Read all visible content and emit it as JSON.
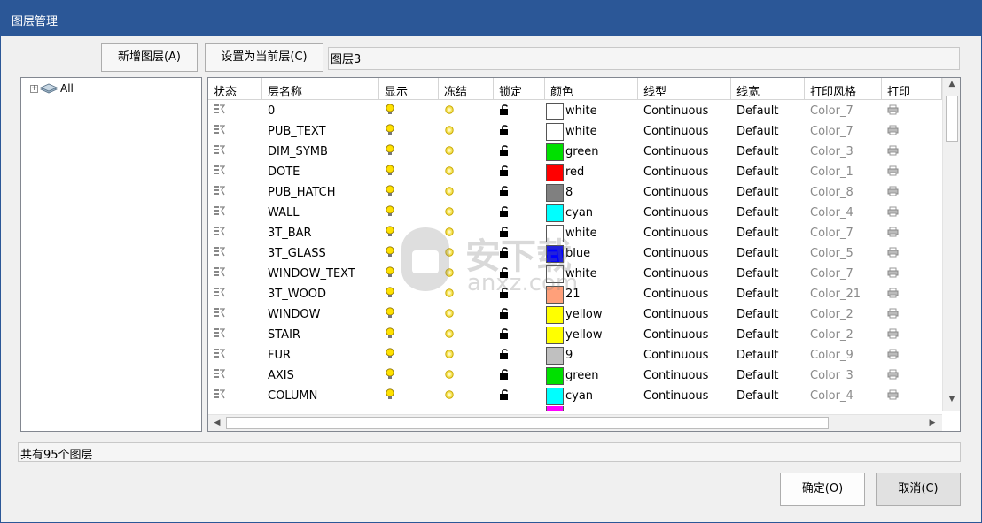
{
  "window": {
    "title": "图层管理"
  },
  "toolbar": {
    "new_layer_label": "新增图层(A)",
    "set_current_label": "设置为当前层(C)",
    "current_layer_value": "图层3"
  },
  "tree": {
    "root_label": "All",
    "expander": "⊞"
  },
  "grid": {
    "headers": [
      "状态",
      "层名称",
      "显示",
      "冻结",
      "锁定",
      "颜色",
      "线型",
      "线宽",
      "打印风格",
      "打印"
    ],
    "rows": [
      {
        "name": "0",
        "color_name": "white",
        "color_hex": "#ffffff",
        "linetype": "Continuous",
        "lineweight": "Default",
        "plot_style": "Color_7"
      },
      {
        "name": "PUB_TEXT",
        "color_name": "white",
        "color_hex": "#ffffff",
        "linetype": "Continuous",
        "lineweight": "Default",
        "plot_style": "Color_7"
      },
      {
        "name": "DIM_SYMB",
        "color_name": "green",
        "color_hex": "#00e000",
        "linetype": "Continuous",
        "lineweight": "Default",
        "plot_style": "Color_3"
      },
      {
        "name": "DOTE",
        "color_name": "red",
        "color_hex": "#ff0000",
        "linetype": "Continuous",
        "lineweight": "Default",
        "plot_style": "Color_1"
      },
      {
        "name": "PUB_HATCH",
        "color_name": "8",
        "color_hex": "#808080",
        "linetype": "Continuous",
        "lineweight": "Default",
        "plot_style": "Color_8"
      },
      {
        "name": "WALL",
        "color_name": "cyan",
        "color_hex": "#00ffff",
        "linetype": "Continuous",
        "lineweight": "Default",
        "plot_style": "Color_4"
      },
      {
        "name": "3T_BAR",
        "color_name": "white",
        "color_hex": "#ffffff",
        "linetype": "Continuous",
        "lineweight": "Default",
        "plot_style": "Color_7"
      },
      {
        "name": "3T_GLASS",
        "color_name": "blue",
        "color_hex": "#0000ff",
        "linetype": "Continuous",
        "lineweight": "Default",
        "plot_style": "Color_5"
      },
      {
        "name": "WINDOW_TEXT",
        "color_name": "white",
        "color_hex": "#ffffff",
        "linetype": "Continuous",
        "lineweight": "Default",
        "plot_style": "Color_7"
      },
      {
        "name": "3T_WOOD",
        "color_name": "21",
        "color_hex": "#ffa07a",
        "linetype": "Continuous",
        "lineweight": "Default",
        "plot_style": "Color_21"
      },
      {
        "name": "WINDOW",
        "color_name": "yellow",
        "color_hex": "#ffff00",
        "linetype": "Continuous",
        "lineweight": "Default",
        "plot_style": "Color_2"
      },
      {
        "name": "STAIR",
        "color_name": "yellow",
        "color_hex": "#ffff00",
        "linetype": "Continuous",
        "lineweight": "Default",
        "plot_style": "Color_2"
      },
      {
        "name": "FUR",
        "color_name": "9",
        "color_hex": "#c0c0c0",
        "linetype": "Continuous",
        "lineweight": "Default",
        "plot_style": "Color_9"
      },
      {
        "name": "AXIS",
        "color_name": "green",
        "color_hex": "#00e000",
        "linetype": "Continuous",
        "lineweight": "Default",
        "plot_style": "Color_3"
      },
      {
        "name": "COLUMN",
        "color_name": "cyan",
        "color_hex": "#00ffff",
        "linetype": "Continuous",
        "lineweight": "Default",
        "plot_style": "Color_4"
      }
    ],
    "partial_row_color_hex": "#ff00ff"
  },
  "icons": {
    "status": "layer-status-icon",
    "visible": "lightbulb-on-icon",
    "frozen": "sun-thawed-icon",
    "locked": "padlock-unlocked-icon",
    "plot": "printer-icon"
  },
  "status_bar": {
    "text": "共有95个图层"
  },
  "footer": {
    "ok_label": "确定(O)",
    "cancel_label": "取消(C)"
  },
  "watermark": {
    "text": "安下载",
    "subtext": "anxz.com"
  }
}
